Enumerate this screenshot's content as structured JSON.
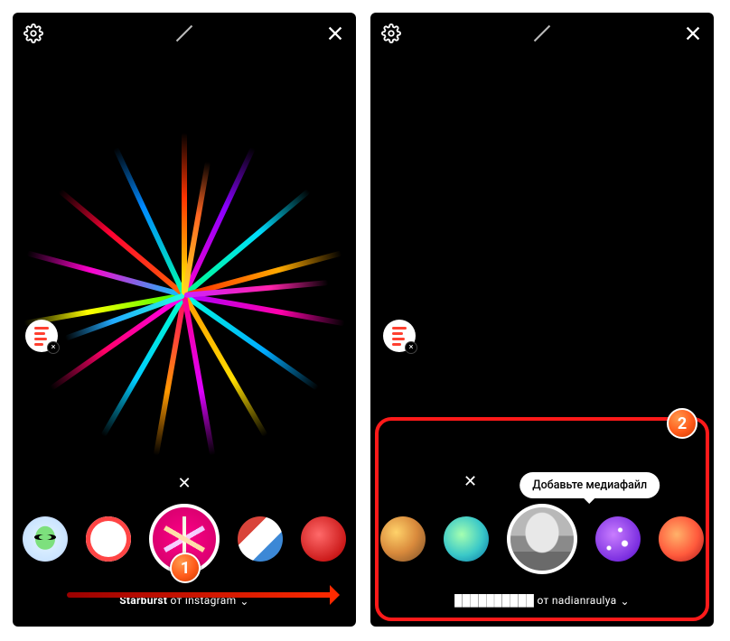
{
  "annotations": {
    "badge1": "1",
    "badge2": "2"
  },
  "left": {
    "attribution": {
      "name": "Starburst",
      "sep": " от ",
      "author": "instagram",
      "chevron": "⌄"
    }
  },
  "right": {
    "tooltip": "Добавьте медиафайл",
    "attribution": {
      "name": "██████████",
      "sep": " от ",
      "author": "nadianraulya",
      "chevron": "⌄"
    }
  }
}
